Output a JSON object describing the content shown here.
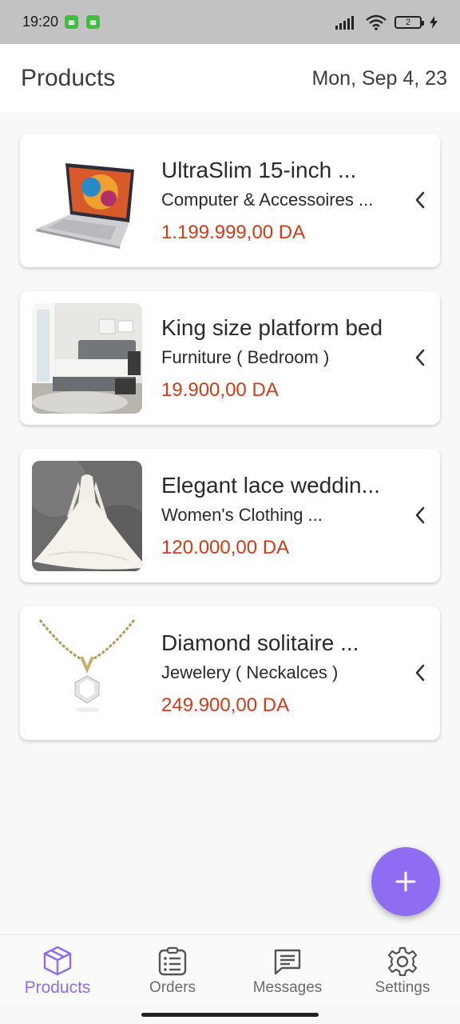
{
  "status_bar": {
    "time": "19:20",
    "battery": "2"
  },
  "header": {
    "title": "Products",
    "date": "Mon, Sep 4, 23"
  },
  "products": [
    {
      "title": "UltraSlim 15-inch ...",
      "category": "Computer & Accessoires ...",
      "price": "1.199.999,00 DA",
      "image": "laptop"
    },
    {
      "title": "King size platform bed",
      "category": "Furniture ( Bedroom )",
      "price": "19.900,00 DA",
      "image": "bed"
    },
    {
      "title": "Elegant lace weddin...",
      "category": "Women's Clothing ...",
      "price": "120.000,00 DA",
      "image": "wedding-dress"
    },
    {
      "title": "Diamond solitaire ...",
      "category": "Jewelery ( Neckalces )",
      "price": "249.900,00 DA",
      "image": "necklace"
    }
  ],
  "fab": {
    "icon": "plus-icon"
  },
  "bottom_nav": [
    {
      "label": "Products",
      "icon": "box-icon",
      "active": true
    },
    {
      "label": "Orders",
      "icon": "list-icon",
      "active": false
    },
    {
      "label": "Messages",
      "icon": "message-icon",
      "active": false
    },
    {
      "label": "Settings",
      "icon": "gear-icon",
      "active": false
    }
  ],
  "colors": {
    "accent": "#8f6df2",
    "price": "#d33b16",
    "status_bar": "#c2c2c2"
  }
}
